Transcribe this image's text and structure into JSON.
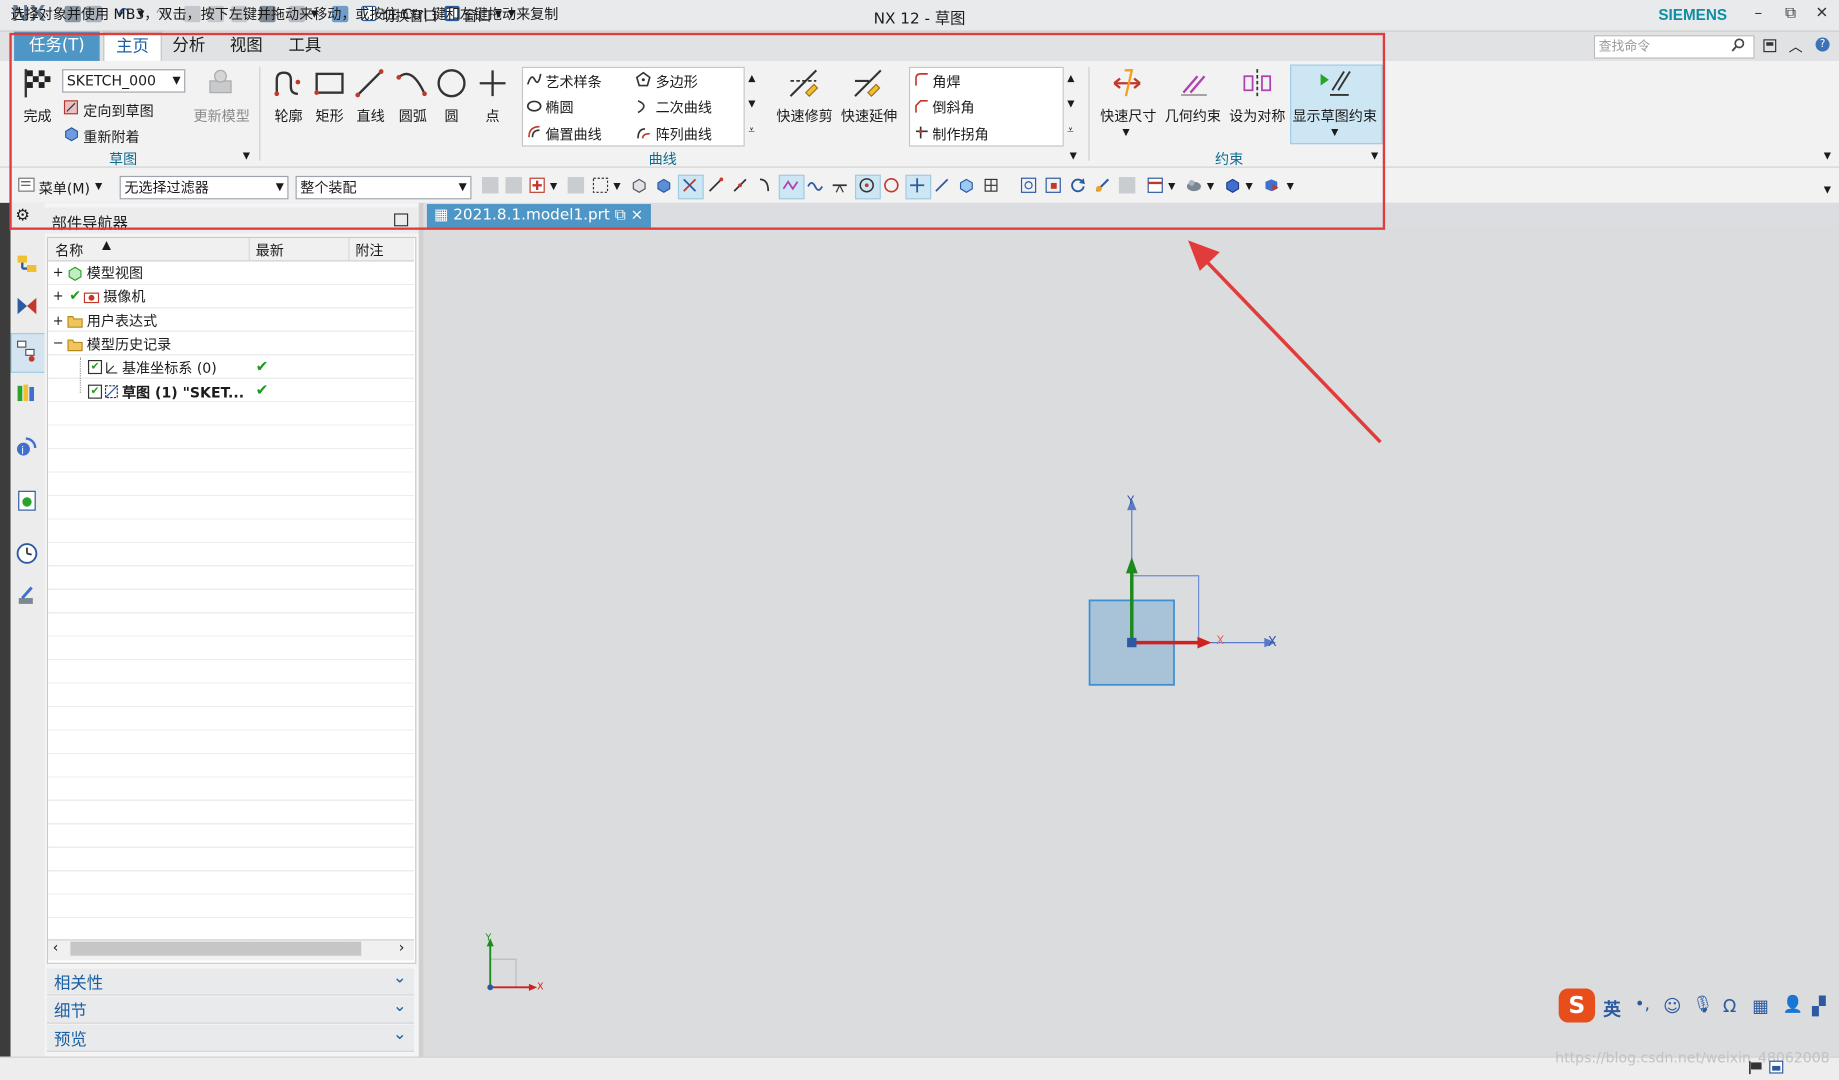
{
  "app": {
    "logo": "NX",
    "window_title": "NX 12 - 草图",
    "brand": "SIEMENS",
    "quick_access": {
      "switch_window": "切换窗口",
      "window": "窗口"
    },
    "window_controls": {
      "minimize": "–",
      "restore": "⧉",
      "close": "✕"
    }
  },
  "ribbon_tabs": [
    {
      "label": "任务(T)"
    },
    {
      "label": "主页"
    },
    {
      "label": "分析"
    },
    {
      "label": "视图"
    },
    {
      "label": "工具"
    }
  ],
  "search": {
    "placeholder": "查找命令"
  },
  "ribbon": {
    "sketch_group": {
      "finish": "完成",
      "sketch_name": "SKETCH_000",
      "orient": "定向到草图",
      "reattach": "重新附着",
      "update_model": "更新模型",
      "label": "草图"
    },
    "curve_group": {
      "tools": [
        "轮廓",
        "矩形",
        "直线",
        "圆弧",
        "圆",
        "点"
      ],
      "list_a": [
        "艺术样条",
        "椭圆",
        "偏置曲线"
      ],
      "list_b": [
        "多边形",
        "二次曲线",
        "阵列曲线"
      ],
      "quick_trim": "快速修剪",
      "quick_extend": "快速延伸",
      "list_c": [
        "角焊",
        "倒斜角",
        "制作拐角"
      ],
      "label": "曲线"
    },
    "constraint_group": {
      "quick_dim": "快速尺寸",
      "geo_constraint": "几何约束",
      "symmetric": "设为对称",
      "show_constraints": "显示草图约束",
      "label": "约束"
    }
  },
  "toolbar2": {
    "menu": "菜单(M)",
    "filter": "无选择过滤器",
    "assembly": "整个装配"
  },
  "navigator": {
    "title": "部件导航器",
    "columns": [
      "名称",
      "最新",
      "附注"
    ],
    "rows": [
      {
        "name": "模型视图",
        "latest": ""
      },
      {
        "name": "摄像机",
        "latest": ""
      },
      {
        "name": "用户表达式",
        "latest": ""
      },
      {
        "name": "模型历史记录",
        "latest": ""
      },
      {
        "name": "基准坐标系 (0)",
        "latest": "✔"
      },
      {
        "name": "草图 (1) \"SKET...",
        "latest": "✔"
      }
    ],
    "panels": [
      "相关性",
      "细节",
      "预览"
    ]
  },
  "document": {
    "tab": "2021.8.1.model1.prt"
  },
  "axes": {
    "x": "X",
    "y": "Y"
  },
  "status": {
    "text": "选择对象并使用 MB3，双击，按下左键并拖动来移动，或按住 Ctrl 键和左键拖动来复制",
    "watermark": "https://blog.csdn.net/weixin_48062008"
  },
  "ime": {
    "lang": "英"
  },
  "colors": {
    "accent": "#4e96c6",
    "highlight_box": "#e23b3b",
    "brand": "#0f8ea3",
    "check": "#1c9a1c"
  }
}
